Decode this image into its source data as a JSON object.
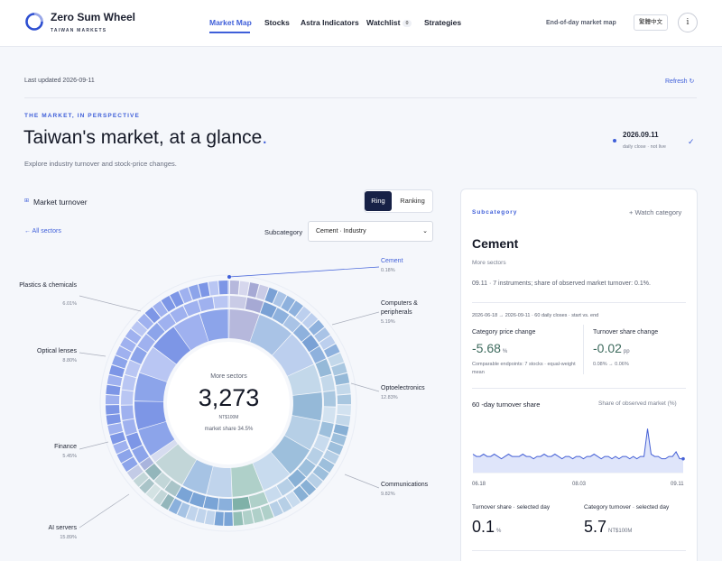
{
  "brand": {
    "name": "Zero Sum Wheel",
    "subtitle": "TAIWAN MARKETS"
  },
  "nav": [
    {
      "label": "Market Map",
      "active": true
    },
    {
      "label": "Stocks"
    },
    {
      "label": "Astra Indicators"
    },
    {
      "label": "Watchlist",
      "badge": "0"
    },
    {
      "label": "Strategies"
    }
  ],
  "header": {
    "eod_label": "End-of-day market map",
    "language_button": "繁體中文",
    "info_icon": "info-icon"
  },
  "status": {
    "last_updated": "Last updated 2026-09-11",
    "refresh": "Refresh ↻"
  },
  "hero": {
    "eyebrow": "THE MARKET, IN PERSPECTIVE",
    "title": "Taiwan's market, at a glance",
    "title_dot": ".",
    "subtitle": "Explore industry turnover and stock-price changes.",
    "date": "2026.09.11",
    "date_note": "daily close · not live",
    "check": "✓"
  },
  "market": {
    "title": "Market turnover",
    "toggle": {
      "ring": "Ring",
      "ranking": "Ranking",
      "selected": "ring"
    },
    "back_link": "← All sectors",
    "subcategory_label": "Subcategory",
    "subcategory_value": "Cement · Industry",
    "center": {
      "label": "More sectors",
      "value": "3,273",
      "unit": "NT$100M",
      "share": "market share 34.5%"
    },
    "sectors": [
      {
        "name": "Cement",
        "pct": "0.18%"
      },
      {
        "name": "Computers & peripherals",
        "pct": "5.19%"
      },
      {
        "name": "Optoelectronics",
        "pct": "12.83%"
      },
      {
        "name": "Communications",
        "pct": "9.82%"
      },
      {
        "name": "AI servers",
        "pct": "15.89%"
      },
      {
        "name": "Finance",
        "pct": "5.45%"
      },
      {
        "name": "Optical lenses",
        "pct": "8.80%"
      },
      {
        "name": "Plastics & chemicals",
        "pct": "6.01%"
      }
    ]
  },
  "panel": {
    "eyebrow": "Subcategory",
    "watch": "+ Watch category",
    "title": "Cement",
    "more": "More sectors",
    "summary": "09.11 · 7 instruments; share of observed market turnover: 0.1%.",
    "range": "2026-06-18 → 2026-09-11 · 60 daily closes · start vs. end",
    "price_change": {
      "label": "Category price change",
      "value": "-5.68",
      "unit": "%",
      "note": "Comparable endpoints: 7 stocks · equal-weight mean"
    },
    "share_change": {
      "label": "Turnover share change",
      "value": "-0.02",
      "unit": "pp",
      "note": "0.08% → 0.06%"
    },
    "chart_title": "60 -day turnover share",
    "chart_right": "Share of observed market (%)",
    "x_ticks": [
      "06.18",
      "08.03",
      "09.11"
    ],
    "turnover_share": {
      "label": "Turnover share · selected day",
      "value": "0.1",
      "unit": "%"
    },
    "category_turnover": {
      "label": "Category turnover · selected day",
      "value": "5.7",
      "unit": "NT$100M"
    }
  },
  "chart_data": {
    "type": "area",
    "title": "60 -day turnover share",
    "ylabel": "Share of observed market (%)",
    "x": [
      "06.18",
      "08.03",
      "09.11"
    ],
    "values": [
      0.08,
      0.07,
      0.07,
      0.08,
      0.07,
      0.07,
      0.08,
      0.07,
      0.06,
      0.07,
      0.08,
      0.07,
      0.07,
      0.07,
      0.08,
      0.07,
      0.07,
      0.06,
      0.07,
      0.07,
      0.08,
      0.07,
      0.07,
      0.08,
      0.07,
      0.06,
      0.07,
      0.07,
      0.06,
      0.07,
      0.07,
      0.06,
      0.07,
      0.07,
      0.08,
      0.07,
      0.06,
      0.07,
      0.07,
      0.06,
      0.07,
      0.06,
      0.07,
      0.07,
      0.06,
      0.07,
      0.06,
      0.07,
      0.07,
      0.19,
      0.08,
      0.07,
      0.07,
      0.06,
      0.06,
      0.07,
      0.07,
      0.09,
      0.06,
      0.06
    ],
    "ylim": [
      0,
      0.25
    ],
    "colors": {
      "line": "#4661d6",
      "fill": "#dfe5fa"
    }
  },
  "colors": {
    "accent": "#3f5fd9",
    "navy": "#172146",
    "positive_green": "#3e6b5e"
  }
}
